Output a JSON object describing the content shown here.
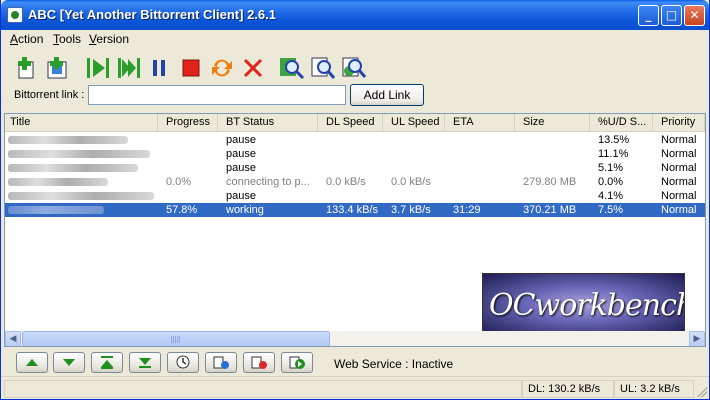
{
  "window": {
    "title": "ABC [Yet Another Bittorrent Client] 2.6.1",
    "buttons": {
      "minimize": "_",
      "maximize": "□",
      "close": "✕"
    }
  },
  "menu": [
    "Action",
    "Tools",
    "Version"
  ],
  "toolbar_icons": [
    "add-torrent-file-icon",
    "add-torrent-url-icon",
    "resume-icon",
    "resume-all-icon",
    "pause-icon",
    "stop-icon",
    "queue-icon",
    "remove-icon",
    "torrent-details-icon",
    "search-icon",
    "web-search-icon"
  ],
  "link_row": {
    "label": "Bittorrent link :",
    "value": "",
    "button": "Add Link"
  },
  "columns": [
    "Title",
    "Progress",
    "BT Status",
    "DL Speed",
    "UL Speed",
    "ETA",
    "Size",
    "%U/D S...",
    "Priority"
  ],
  "rows": [
    {
      "progress": "",
      "status": "pause",
      "dl": "",
      "ul": "",
      "eta": "",
      "size": "",
      "ratio": "13.5%",
      "priority": "Normal",
      "selected": false,
      "dim": false
    },
    {
      "progress": "",
      "status": "pause",
      "dl": "",
      "ul": "",
      "eta": "",
      "size": "",
      "ratio": "11.1%",
      "priority": "Normal",
      "selected": false,
      "dim": false
    },
    {
      "progress": "",
      "status": "pause",
      "dl": "",
      "ul": "",
      "eta": "",
      "size": "",
      "ratio": "5.1%",
      "priority": "Normal",
      "selected": false,
      "dim": false
    },
    {
      "progress": "0.0%",
      "status": "connecting to p...",
      "dl": "0.0 kB/s",
      "ul": "0.0 kB/s",
      "eta": "",
      "size": "279.80 MB",
      "ratio": "0.0%",
      "priority": "Normal",
      "selected": false,
      "dim": true
    },
    {
      "progress": "",
      "status": "pause",
      "dl": "",
      "ul": "",
      "eta": "",
      "size": "",
      "ratio": "4.1%",
      "priority": "Normal",
      "selected": false,
      "dim": false
    },
    {
      "progress": "57.8%",
      "status": "working",
      "dl": "133.4 kB/s",
      "ul": "3.7 kB/s",
      "eta": "31:29",
      "size": "370.21 MB",
      "ratio": "7.5%",
      "priority": "Normal",
      "selected": true,
      "dim": false
    }
  ],
  "logo": {
    "text": "OCworkbench"
  },
  "scrollbar": {
    "left": "◀",
    "right": "▶"
  },
  "bottom_buttons": [
    "move-up-icon",
    "move-down-icon",
    "move-top-icon",
    "move-bottom-icon",
    "scheduler-icon",
    "peer-info-icon",
    "stop-upload-icon",
    "go-icon"
  ],
  "web_service": "Web Service : Inactive",
  "status": {
    "dl": "DL: 130.2 kB/s",
    "ul": "UL: 3.2 kB/s"
  },
  "colors": {
    "titlebar": "#0A5FE8",
    "selection": "#316AC5",
    "face": "#ECE9D8"
  }
}
